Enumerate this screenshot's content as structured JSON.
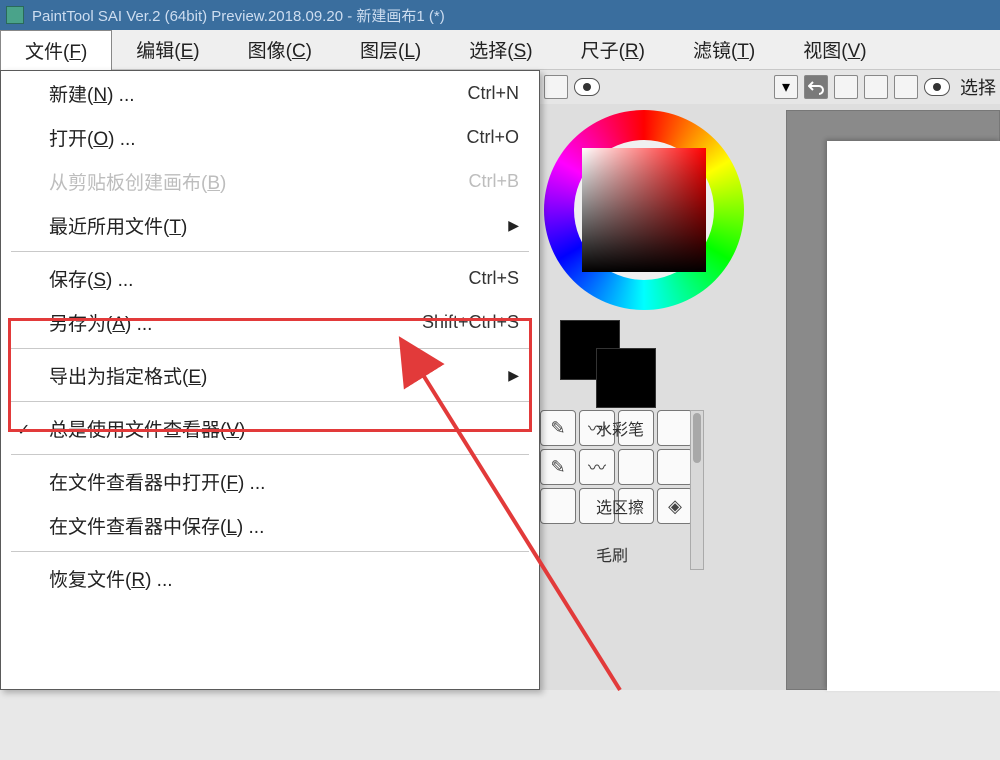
{
  "titlebar": {
    "text": "PaintTool SAI Ver.2 (64bit) Preview.2018.09.20 - 新建画布1 (*)"
  },
  "menubar": {
    "file": {
      "label": "文件(",
      "key": "F",
      "tail": ")"
    },
    "edit": {
      "label": "编辑(",
      "key": "E",
      "tail": ")"
    },
    "image": {
      "label": "图像(",
      "key": "C",
      "tail": ")"
    },
    "layer": {
      "label": "图层(",
      "key": "L",
      "tail": ")"
    },
    "select": {
      "label": "选择(",
      "key": "S",
      "tail": ")"
    },
    "ruler": {
      "label": "尺子(",
      "key": "R",
      "tail": ")"
    },
    "filter": {
      "label": "滤镜(",
      "key": "T",
      "tail": ")"
    },
    "view": {
      "label": "视图(",
      "key": "V",
      "tail": ")"
    }
  },
  "dropdown": {
    "new": {
      "label": "新建(",
      "key": "N",
      "tail": ") ...",
      "shortcut": "Ctrl+N"
    },
    "open": {
      "label": "打开(",
      "key": "O",
      "tail": ") ...",
      "shortcut": "Ctrl+O"
    },
    "from_clip": {
      "label": "从剪贴板创建画布(",
      "key": "B",
      "tail": ")",
      "shortcut": "Ctrl+B"
    },
    "recent": {
      "label": "最近所用文件(",
      "key": "T",
      "tail": ")"
    },
    "save": {
      "label": "保存(",
      "key": "S",
      "tail": ") ...",
      "shortcut": "Ctrl+S"
    },
    "saveas": {
      "label": "另存为(",
      "key": "A",
      "tail": ") ...",
      "shortcut": "Shift+Ctrl+S"
    },
    "export": {
      "label": "导出为指定格式(",
      "key": "E",
      "tail": ")"
    },
    "always": {
      "label": "总是使用文件查看器(",
      "key": "V",
      "tail": ")"
    },
    "open_viewer": {
      "label": "在文件查看器中打开(",
      "key": "F",
      "tail": ") ..."
    },
    "save_viewer": {
      "label": "在文件查看器中保存(",
      "key": "L",
      "tail": ") ..."
    },
    "revert": {
      "label": "恢复文件(",
      "key": "R",
      "tail": ") ..."
    }
  },
  "rightpanel": {
    "select_label": "选择",
    "tools": {
      "watercolor": "水彩笔",
      "area": "选区擦",
      "brush": "毛刷"
    }
  }
}
